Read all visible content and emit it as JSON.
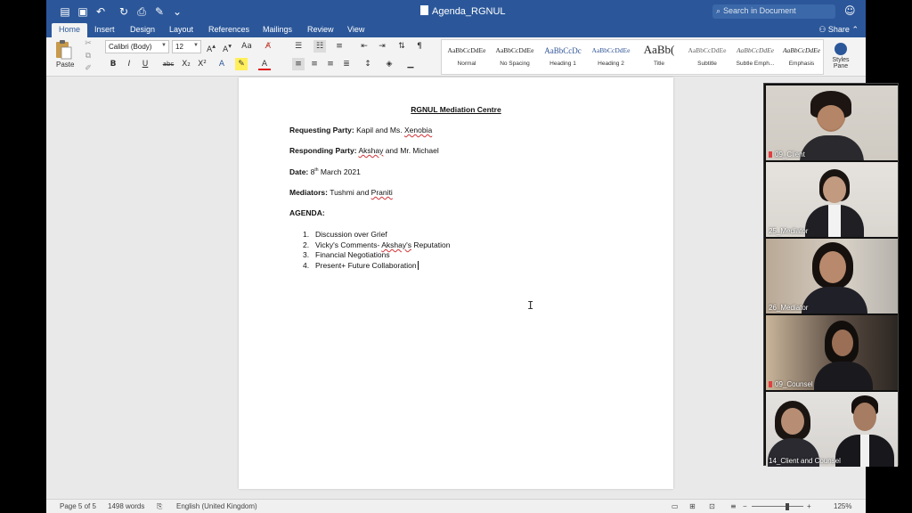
{
  "window": {
    "title": "Agenda_RGNUL",
    "search_placeholder": "Search in Document"
  },
  "tabs": [
    "Home",
    "Insert",
    "Design",
    "Layout",
    "References",
    "Mailings",
    "Review",
    "View"
  ],
  "share_label": "Share",
  "ribbon": {
    "paste_label": "Paste",
    "font_name": "Calibri (Body)",
    "font_size": "12",
    "styles": [
      {
        "preview": "AaBbCcDdEe",
        "name": "Normal"
      },
      {
        "preview": "AaBbCcDdEe",
        "name": "No Spacing"
      },
      {
        "preview": "AaBbCcDc",
        "name": "Heading 1"
      },
      {
        "preview": "AaBbCcDdEe",
        "name": "Heading 2"
      },
      {
        "preview": "AaBb(",
        "name": "Title"
      },
      {
        "preview": "AaBbCcDdEe",
        "name": "Subtitle"
      },
      {
        "preview": "AaBbCcDdEe",
        "name": "Subtle Emph..."
      },
      {
        "preview": "AaBbCcDdEe",
        "name": "Emphasis"
      }
    ],
    "styles_pane_label": "Styles Pane"
  },
  "document": {
    "heading": "RGNUL Mediation Centre",
    "requesting_label": "Requesting Party:",
    "requesting_value_a": "Kapil and Ms. ",
    "requesting_value_b": "Xenobia",
    "responding_label": "Responding Party:",
    "responding_value_a": "Akshay",
    "responding_value_b": " and Mr. Michael",
    "date_label": "Date:",
    "date_day": "8",
    "date_suffix": "th",
    "date_rest": " March 2021",
    "mediators_label": "Mediators:",
    "mediators_value_a": "Tushmi and ",
    "mediators_value_b": "Praniti",
    "agenda_label": "AGENDA:",
    "agenda_items": [
      {
        "num": "1.",
        "text": "Discussion over Grief"
      },
      {
        "num": "2.",
        "text_a": "Vicky's Comments- ",
        "text_b": "Akshay's",
        "text_c": " Reputation"
      },
      {
        "num": "3.",
        "text": "Financial Negotiations"
      },
      {
        "num": "4.",
        "text": "Present+ Future Collaboration"
      }
    ]
  },
  "status": {
    "page": "Page 5 of 5",
    "words": "1498 words",
    "language": "English (United Kingdom)",
    "zoom": "125%"
  },
  "participants": [
    {
      "name": "09_Client",
      "muted": true
    },
    {
      "name": "25_Mediator",
      "muted": false
    },
    {
      "name": "26_Mediator",
      "muted": false
    },
    {
      "name": "09_Counsel",
      "muted": true
    },
    {
      "name": "14_Client and Counsel",
      "muted": false
    }
  ],
  "colors": {
    "word_blue": "#2b579a",
    "spell_underline": "#d13438"
  }
}
